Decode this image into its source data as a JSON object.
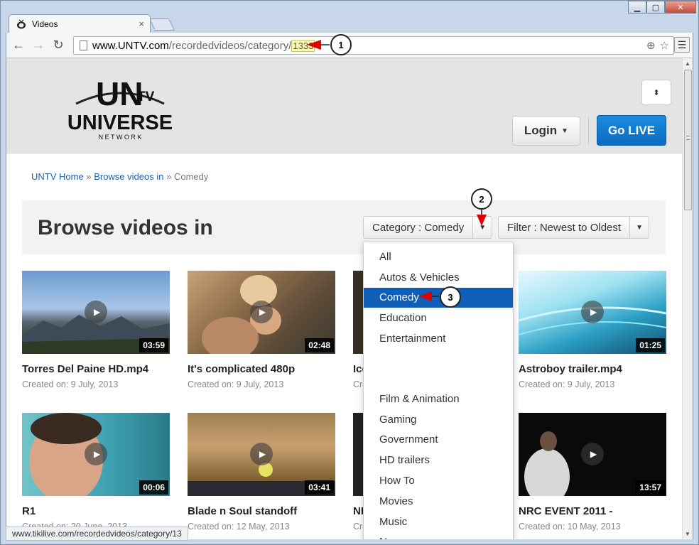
{
  "browser": {
    "tab_title": "Videos",
    "tab_close": "×",
    "window_buttons": {
      "minimize": "▁",
      "maximize": "▢",
      "close": "✕"
    },
    "url_host": "www.UNTV.com",
    "url_path": "/recordedvideos/category/",
    "url_id": "1333",
    "status_url": "www.tikilive.com/recordedvideos/category/13"
  },
  "header": {
    "logo_un": "UN",
    "logo_tv": "TV",
    "logo_universe": "UNIVERSE",
    "logo_network": "N E T W O R K",
    "toggle_label": "⬍",
    "login_label": "Login",
    "golive_label": "Go LIVE"
  },
  "breadcrumb": {
    "brand": "UNTV",
    "home": "Home",
    "sep1": "»",
    "browse": "Browse videos in",
    "sep2": "»",
    "current": "Comedy"
  },
  "page": {
    "title": "Browse videos in",
    "category_label": "Category : Comedy",
    "filter_label": "Filter : Newest to Oldest"
  },
  "dropdown": {
    "top_items": [
      "All",
      "Autos & Vehicles",
      "Comedy",
      "Education",
      "Entertainment"
    ],
    "bottom_items": [
      "Film & Animation",
      "Gaming",
      "Government",
      "HD trailers",
      "How To",
      "Movies",
      "Music",
      "News"
    ],
    "active_item": "Comedy"
  },
  "videos": [
    {
      "title": "Torres Del Paine HD.mp4",
      "date": "Created on: 9 July, 2013",
      "duration": "03:59"
    },
    {
      "title": "It's complicated 480p",
      "date": "Created on: 9 July, 2013",
      "duration": "02:48"
    },
    {
      "title": "Ice",
      "date": "Cre",
      "duration": ""
    },
    {
      "title": "Astroboy trailer.mp4",
      "date": "Created on: 9 July, 2013",
      "duration": "01:25"
    },
    {
      "title": "R1",
      "date": "Created on: 20 June, 2013",
      "duration": "00:06"
    },
    {
      "title": "Blade n Soul standoff",
      "date": "Created on: 12 May, 2013",
      "duration": "03:41"
    },
    {
      "title": "NI",
      "date": "Cre",
      "duration": ""
    },
    {
      "title": "NRC EVENT 2011 -",
      "date": "Created on: 10 May, 2013",
      "duration": "13:57"
    }
  ],
  "annotations": [
    "1",
    "2",
    "3"
  ],
  "colors": {
    "accent_blue": "#0f5fb8",
    "golive": "#1a8be0",
    "annotation_arrow": "#e00000"
  }
}
